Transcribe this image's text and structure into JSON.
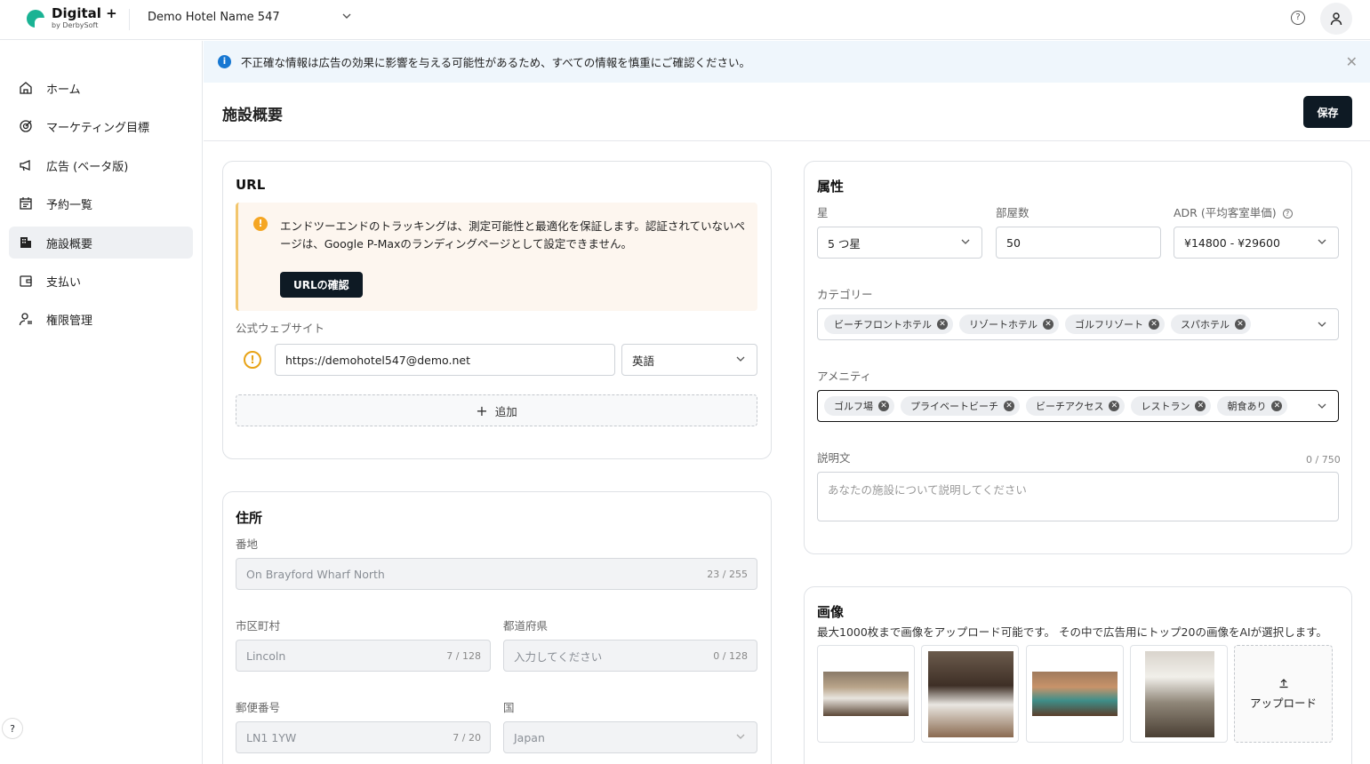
{
  "brand": {
    "title": "Digital +",
    "subtitle": "by DerbySoft"
  },
  "header": {
    "hotel_name": "Demo Hotel Name 547"
  },
  "sidebar": {
    "items": [
      {
        "label": "ホーム"
      },
      {
        "label": "マーケティング目標"
      },
      {
        "label": "広告 (ベータ版)"
      },
      {
        "label": "予約一覧"
      },
      {
        "label": "施設概要"
      },
      {
        "label": "支払い"
      },
      {
        "label": "権限管理"
      }
    ]
  },
  "banner": {
    "text": "不正確な情報は広告の効果に影響を与える可能性があるため、すべての情報を慎重にご確認ください。"
  },
  "page": {
    "title": "施設概要",
    "save_label": "保存"
  },
  "url_card": {
    "title": "URL",
    "warning_text": "エンドツーエンドのトラッキングは、測定可能性と最適化を保証します。認証されていないページは、Google P-Maxのランディングページとして設定できません。",
    "verify_button": "URLの確認",
    "website_label": "公式ウェブサイト",
    "website_value": "https://demohotel547@demo.net",
    "language_value": "英語",
    "add_label": "追加"
  },
  "address_card": {
    "title": "住所",
    "street_label": "番地",
    "street_value": "On Brayford Wharf North",
    "street_count": "23 / 255",
    "city_label": "市区町村",
    "city_value": "Lincoln",
    "city_count": "7 / 128",
    "prefecture_label": "都道府県",
    "prefecture_placeholder": "入力してください",
    "prefecture_count": "0 / 128",
    "postal_label": "郵便番号",
    "postal_value": "LN1 1YW",
    "postal_count": "7 / 20",
    "country_label": "国",
    "country_value": "Japan"
  },
  "attributes_card": {
    "title": "属性",
    "star_label": "星",
    "star_value": "5 つ星",
    "rooms_label": "部屋数",
    "rooms_value": "50",
    "adr_label": "ADR (平均客室単価)",
    "adr_value": "¥14800 - ¥29600",
    "category_label": "カテゴリー",
    "categories": [
      "ビーチフロントホテル",
      "リゾートホテル",
      "ゴルフリゾート",
      "スパホテル"
    ],
    "amenity_label": "アメニティ",
    "amenities": [
      "ゴルフ場",
      "プライベートビーチ",
      "ビーチアクセス",
      "レストラン",
      "朝食あり"
    ],
    "description_label": "説明文",
    "description_count": "0 / 750",
    "description_placeholder": "あなたの施設について説明してください"
  },
  "images_card": {
    "title": "画像",
    "subtitle": "最大1000枚まで画像をアップロード可能です。 その中で広告用にトップ20の画像をAIが選択します。",
    "upload_label": "アップロード"
  }
}
